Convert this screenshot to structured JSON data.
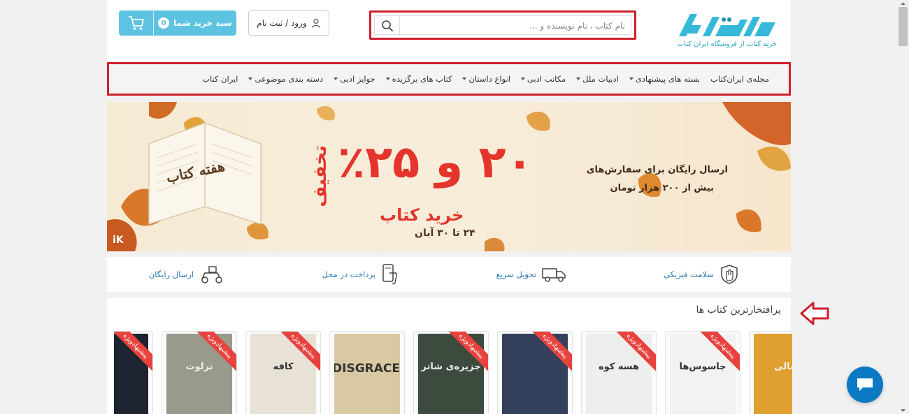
{
  "header": {
    "logo_tagline": "خرید کتاب   از فروشگاه ایران کتاب",
    "search_placeholder": "نام کتاب ، نام نویسنده و ...",
    "login_label": "ورود / ثبت نام",
    "cart_label": "سبد خرید شما",
    "cart_count": "0"
  },
  "nav": {
    "items": [
      {
        "label": "ایران کتاب",
        "dropdown": false
      },
      {
        "label": "دسته بندی موضوعی",
        "dropdown": true
      },
      {
        "label": "جوایز ادبی",
        "dropdown": true
      },
      {
        "label": "کتاب های برگزیده",
        "dropdown": true
      },
      {
        "label": "انواع داستان",
        "dropdown": true
      },
      {
        "label": "مکاتب ادبی",
        "dropdown": true
      },
      {
        "label": "ادبیات ملل",
        "dropdown": true
      },
      {
        "label": "بسته های پیشنهادی",
        "dropdown": true
      },
      {
        "label": "مجله‌ی ایران‌کتاب",
        "dropdown": false
      }
    ]
  },
  "banner": {
    "free_shipping_line1": "ارسال رایگان برای سفارش‌های",
    "free_shipping_line2": "بیش از ۲۰۰ هزار تومان",
    "discount_text": "۲۰ و ۲۵٪",
    "discount_word": "تخفیف",
    "event_title": "خرید کتاب",
    "event_dates": "۲۴ تا ۳۰ آبان",
    "stamp_text": "هفته کتاب",
    "corner_logo": "iK"
  },
  "features": [
    {
      "label": "سلامت فیزیکی",
      "icon": "shield-hand-icon"
    },
    {
      "label": "تحویل سریع",
      "icon": "truck-icon"
    },
    {
      "label": "پرداخت در محل",
      "icon": "phone-payment-icon"
    },
    {
      "label": "ارسال رایگان",
      "icon": "scooter-icon"
    }
  ],
  "bestsellers": {
    "title": "پرافتخارترین کتاب ها",
    "ribbon_label": "پیشنهادویژه",
    "books": [
      {
        "cover_text": "سالی",
        "color": "#e0a030",
        "ribbon": false
      },
      {
        "cover_text": "جاسوس‌ها",
        "color": "#f2f2f2",
        "ribbon": true
      },
      {
        "cover_text": "هسه کوه",
        "color": "#eeeeee",
        "ribbon": true
      },
      {
        "cover_text": "",
        "color": "#33415c",
        "ribbon": true
      },
      {
        "cover_text": "جزیره‌ی شاتر",
        "color": "#3d4a3e",
        "ribbon": true
      },
      {
        "cover_text": "DISGRACE",
        "color": "#d9c9a3",
        "ribbon": false
      },
      {
        "cover_text": "کافه",
        "color": "#e8e2d6",
        "ribbon": true
      },
      {
        "cover_text": "ترلوت",
        "color": "#9a9a8c",
        "ribbon": true
      },
      {
        "cover_text": "",
        "color": "#1d2430",
        "ribbon": true
      }
    ]
  },
  "colors": {
    "accent": "#5ec3e0",
    "highlight_border": "#d0202c",
    "link": "#2a7ab5",
    "ribbon": "#e8423e"
  }
}
